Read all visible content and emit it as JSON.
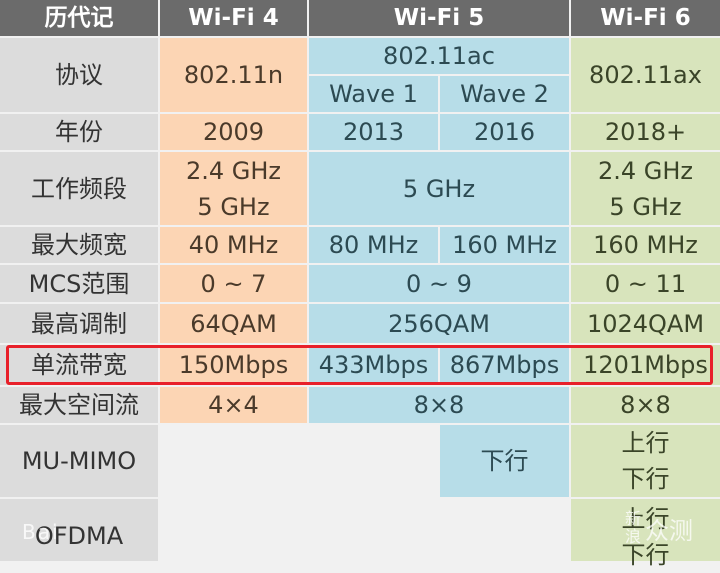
{
  "header": {
    "label": "历代记",
    "wifi4": "Wi-Fi 4",
    "wifi5": "Wi-Fi 5",
    "wifi6": "Wi-Fi 6"
  },
  "rows": {
    "protocol": {
      "label": "协议",
      "wifi4": "802.11n",
      "wifi5": "802.11ac",
      "wave1": "Wave 1",
      "wave2": "Wave 2",
      "wifi6": "802.11ax"
    },
    "year": {
      "label": "年份",
      "wifi4": "2009",
      "wave1": "2013",
      "wave2": "2016",
      "wifi6": "2018+"
    },
    "band": {
      "label": "工作频段",
      "wifi4": [
        "2.4 GHz",
        "5 GHz"
      ],
      "wifi5": "5 GHz",
      "wifi6": [
        "2.4 GHz",
        "5 GHz"
      ]
    },
    "max_bandwidth": {
      "label": "最大频宽",
      "wifi4": "40 MHz",
      "wave1": "80 MHz",
      "wave2": "160 MHz",
      "wifi6": "160 MHz"
    },
    "mcs": {
      "label": "MCS范围",
      "wifi4": "0 ~ 7",
      "wifi5": "0 ~ 9",
      "wifi6": "0 ~ 11"
    },
    "modulation": {
      "label": "最高调制",
      "wifi4": "64QAM",
      "wifi5": "256QAM",
      "wifi6": "1024QAM"
    },
    "single_stream": {
      "label": "单流带宽",
      "wifi4": "150Mbps",
      "wave1": "433Mbps",
      "wave2": "867Mbps",
      "wifi6": "1201Mbps",
      "highlighted": true
    },
    "spatial_streams": {
      "label": "最大空间流",
      "wifi4": "4×4",
      "wifi5": "8×8",
      "wifi6": "8×8"
    },
    "mu_mimo": {
      "label": "MU-MIMO",
      "wifi4": "",
      "wave1": "",
      "wave2": "下行",
      "wifi6": [
        "上行",
        "下行"
      ]
    },
    "ofdma": {
      "label": "OFDMA",
      "wifi4": "",
      "wifi5": "",
      "wifi6": [
        "上行",
        "下行"
      ]
    }
  },
  "colors": {
    "header": "#6b6b6b",
    "label": "#dcdcdc",
    "wifi4": "#fcd5b4",
    "wifi5": "#b7dde8",
    "wifi6": "#d8e4bc",
    "highlight": "#e8202a"
  },
  "watermarks": {
    "left": "Bai",
    "right_small": [
      "新",
      "浪"
    ],
    "right_big": "众测"
  }
}
